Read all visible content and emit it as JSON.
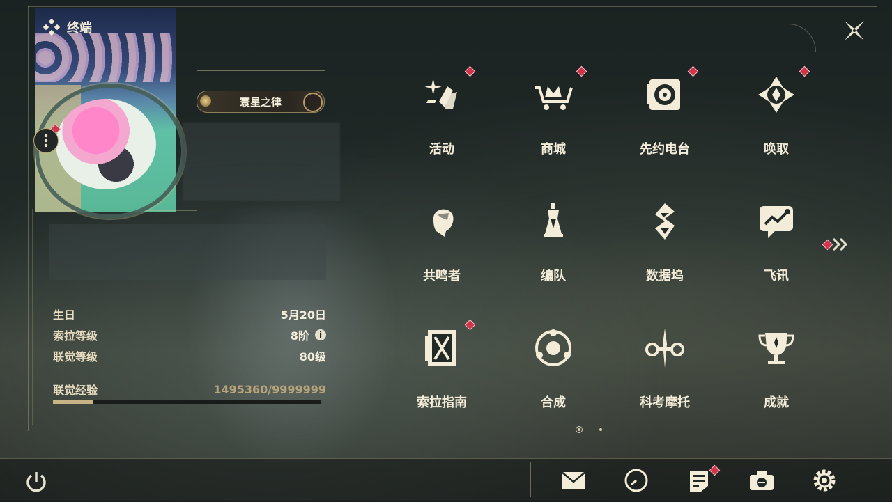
{
  "header": {
    "title": "终端"
  },
  "profile": {
    "title_tag": "寰星之律",
    "stats": [
      {
        "label": "生日",
        "value": "5月20日"
      },
      {
        "label": "索拉等级",
        "value": "8阶"
      },
      {
        "label": "联觉等级",
        "value": "80级"
      }
    ],
    "experience": {
      "label": "联觉经验",
      "value": "1495360/9999999",
      "progress": 0.1495
    }
  },
  "menu": {
    "items": [
      {
        "label": "活动",
        "icon": "activity-icon",
        "badge": true
      },
      {
        "label": "商城",
        "icon": "shop-cart-icon",
        "badge": true
      },
      {
        "label": "先约电台",
        "icon": "radio-icon",
        "badge": true
      },
      {
        "label": "唤取",
        "icon": "summon-icon",
        "badge": true
      },
      {
        "label": "共鸣者",
        "icon": "resonator-icon",
        "badge": false
      },
      {
        "label": "编队",
        "icon": "team-icon",
        "badge": false
      },
      {
        "label": "数据坞",
        "icon": "data-dock-icon",
        "badge": false
      },
      {
        "label": "飞讯",
        "icon": "message-icon",
        "badge": false
      },
      {
        "label": "索拉指南",
        "icon": "guide-icon",
        "badge": true
      },
      {
        "label": "合成",
        "icon": "synthesis-icon",
        "badge": false
      },
      {
        "label": "科考摩托",
        "icon": "motorbike-icon",
        "badge": false
      },
      {
        "label": "成就",
        "icon": "trophy-icon",
        "badge": false
      }
    ],
    "pager": {
      "current": 1,
      "total": 2
    }
  },
  "bottom_bar": {
    "icons": [
      "power-icon",
      "mail-icon",
      "clock-icon",
      "notes-icon",
      "camera-icon",
      "settings-icon"
    ]
  },
  "colors": {
    "accent": "#c7b386",
    "badge": "#d0344a",
    "text": "#f2ecd8"
  }
}
